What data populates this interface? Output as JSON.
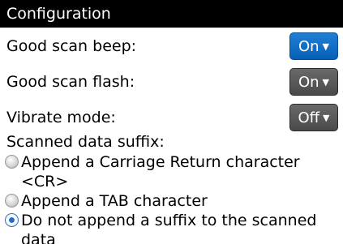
{
  "title": "Configuration",
  "settings": [
    {
      "label": "Good scan beep:",
      "value": "On",
      "icon": "chevron-down-icon",
      "selected": true
    },
    {
      "label": "Good scan flash:",
      "value": "On",
      "icon": "chevron-down-icon",
      "selected": false
    },
    {
      "label": "Vibrate mode:",
      "value": "Off",
      "icon": "chevron-down-icon",
      "selected": false
    }
  ],
  "suffix": {
    "label": "Scanned data suffix:",
    "options": [
      {
        "text": "Append a Carriage Return character <CR>",
        "checked": false
      },
      {
        "text": "Append a TAB character",
        "checked": false
      },
      {
        "text": "Do not append a suffix to the scanned data",
        "checked": true
      }
    ]
  },
  "colors": {
    "selected_dropdown": "#0760b6",
    "dropdown": "#555555",
    "titlebar": "#000000"
  }
}
